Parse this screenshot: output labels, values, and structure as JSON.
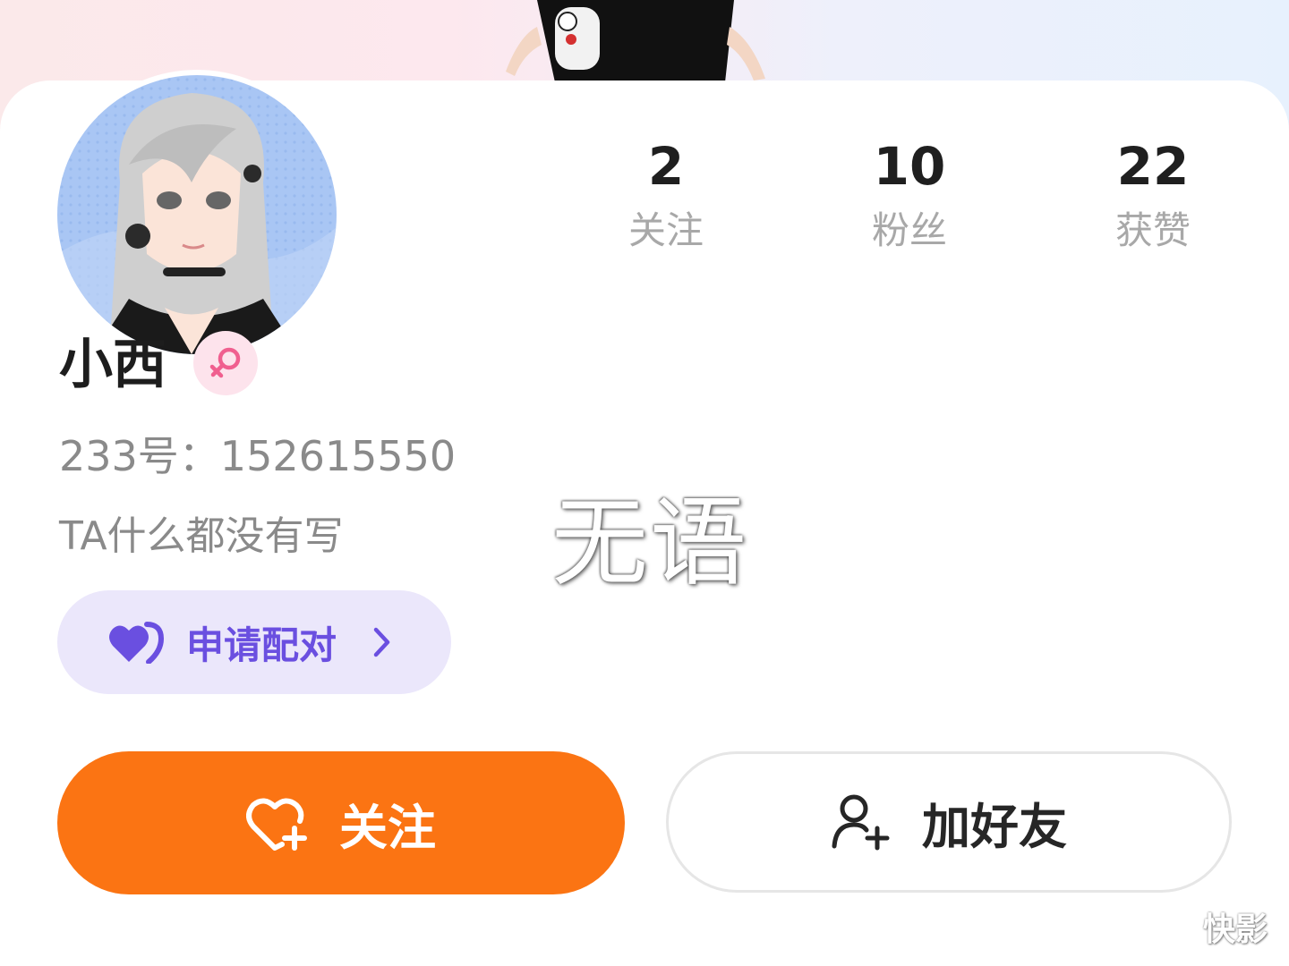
{
  "profile": {
    "name": "小西",
    "gender_icon": "female-icon",
    "uid_text": "233号：152615550",
    "bio": "TA什么都没有写"
  },
  "stats": [
    {
      "value": "2",
      "label": "关注"
    },
    {
      "value": "10",
      "label": "粉丝"
    },
    {
      "value": "22",
      "label": "获赞"
    }
  ],
  "pair_button": {
    "label": "申请配对",
    "icon": "heart-pair-icon"
  },
  "actions": {
    "follow_label": "关注",
    "follow_icon": "heart-plus-icon",
    "add_friend_label": "加好友",
    "add_friend_icon": "user-plus-icon"
  },
  "overlay": {
    "caption": "无语"
  },
  "watermark": {
    "text": "快影"
  },
  "colors": {
    "follow_bg": "#fb7413",
    "pair_bg": "#ebe7fb",
    "pair_accent": "#6a4fe0",
    "gender_bg": "#fde3ec",
    "gender_fg": "#f05f8f"
  }
}
